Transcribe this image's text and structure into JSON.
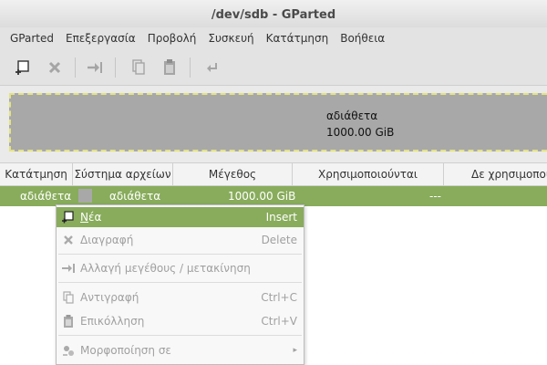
{
  "window": {
    "title": "/dev/sdb - GParted"
  },
  "menubar": [
    "GParted",
    "Επεξεργασία",
    "Προβολή",
    "Συσκευή",
    "Κατάτμηση",
    "Βοήθεια"
  ],
  "toolbar": {
    "icons": [
      "new-partition-icon",
      "delete-icon",
      "resize-move-icon",
      "copy-icon",
      "paste-icon",
      "undo-icon"
    ]
  },
  "disk_graph": {
    "label": "αδιάθετα",
    "size": "1000.00 GiB"
  },
  "table": {
    "columns": [
      "Κατάτμηση",
      "Σύστημα αρχείων",
      "Μέγεθος",
      "Χρησιμοποιούνται",
      "Δε χρησιμοποιού"
    ],
    "rows": [
      {
        "partition": "αδιάθετα",
        "filesystem": "αδιάθετα",
        "size": "1000.00 GiB",
        "used": "---",
        "unused": ""
      }
    ]
  },
  "context_menu": {
    "items": [
      {
        "mnemonic": "Ν",
        "label_rest": "έα",
        "accel": "Insert",
        "icon": "new-partition-icon",
        "enabled": true
      },
      {
        "label": "Διαγραφή",
        "accel": "Delete",
        "icon": "delete-icon",
        "enabled": false
      },
      {
        "label": "Αλλαγή μεγέθους / μετακίνηση",
        "accel": "",
        "icon": "resize-move-icon",
        "enabled": false
      },
      {
        "label": "Αντιγραφή",
        "accel": "Ctrl+C",
        "icon": "copy-icon",
        "enabled": false
      },
      {
        "label": "Επικόλληση",
        "accel": "Ctrl+V",
        "icon": "paste-icon",
        "enabled": false
      },
      {
        "label": "Μορφοποίηση σε",
        "accel": "▸",
        "icon": "format-icon",
        "enabled": false
      }
    ]
  },
  "colors": {
    "selection": "#88ac5c",
    "unallocated": "#a8a8a8"
  }
}
